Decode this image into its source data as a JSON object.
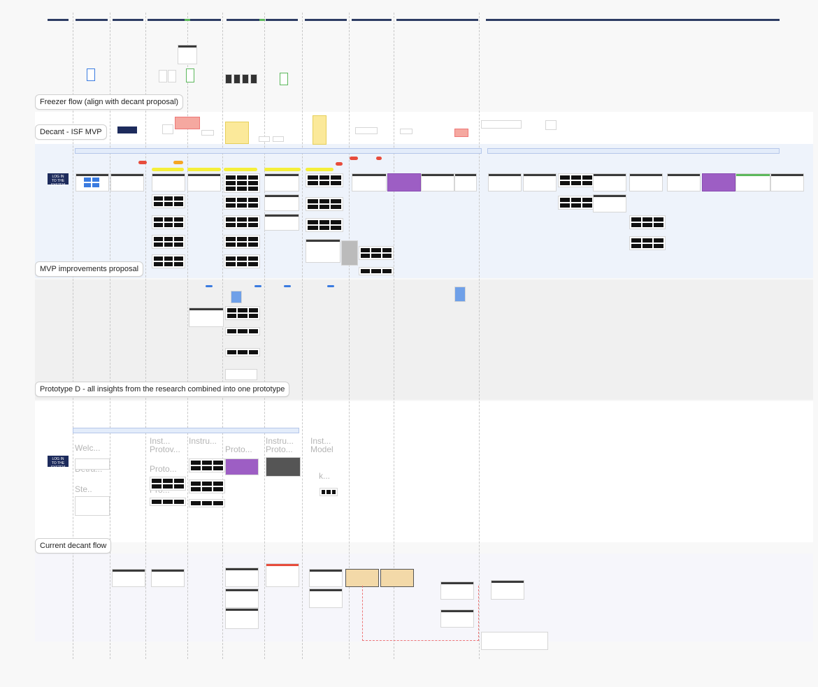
{
  "sections": {
    "freezer": "Freezer flow (align with decant proposal)",
    "decant_isf": "Decant - ISF MVP",
    "mvp_improvements": "MVP improvements proposal",
    "prototype_d": "Prototype D - all insights from the research combined into one prototype",
    "current_decant": "Current decant flow"
  },
  "buttons": {
    "login_top": "LOG IN TO THE SYSTEM",
    "login_bottom": "LOG IN TO THE SYSTEM"
  },
  "ghost_labels": [
    "Inst...",
    "Protov...",
    "Proto...",
    "Pro...",
    "Instru...",
    "Proto...",
    "Instru...",
    "Proto...",
    "Inst...",
    "Model",
    "k...",
    "Welc...",
    "Detra...",
    "Ste.."
  ],
  "colors": {
    "header_bar": "#2d3c64",
    "accent_green": "#5cb85c",
    "highlight_yellow": "#f5ef3a",
    "highlight_purple": "#9d5ec4",
    "alert_red": "#e74c3c",
    "band_mvp": "#eef3fb",
    "band_proto": "#f0f0f0",
    "band_white": "#ffffff"
  }
}
